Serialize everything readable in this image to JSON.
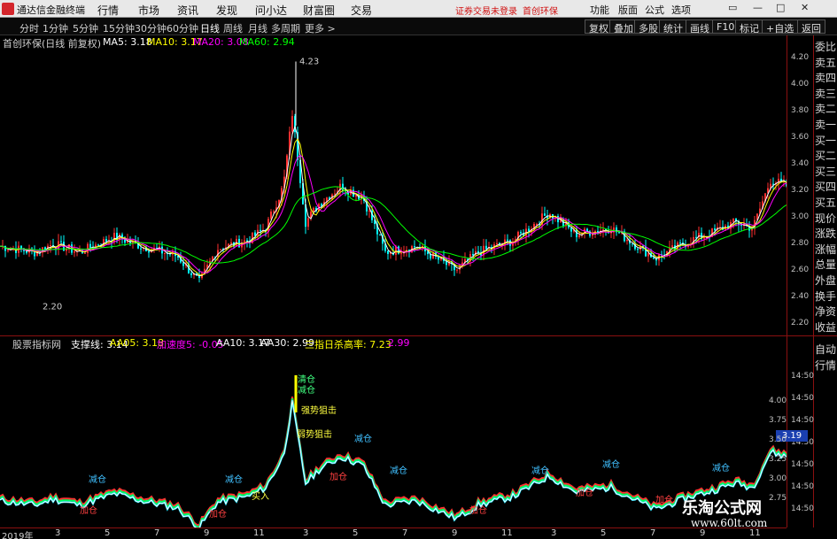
{
  "app": {
    "brand": "通达信金融终端",
    "menu": [
      "行情",
      "市场",
      "资讯",
      "发现",
      "问小达",
      "财富圈",
      "交易"
    ],
    "warning": "证券交易未登录",
    "stock_tag": "首创环保",
    "right_menu": [
      "功能",
      "版面",
      "公式",
      "选项"
    ],
    "window_buttons": [
      "▭",
      "—",
      "□",
      "✕"
    ]
  },
  "toolbar": {
    "periods": [
      "分时",
      "1分钟",
      "5分钟",
      "15分钟",
      "30分钟",
      "60分钟",
      "日线",
      "周线",
      "月线",
      "多周期",
      "更多 >"
    ],
    "active": "日线",
    "right_buttons": [
      "复权",
      "叠加",
      "多股",
      "统计",
      "画线",
      "F10",
      "标记",
      "+自选",
      "返回"
    ]
  },
  "main_chart": {
    "header": {
      "title": "首创环保(日线 前复权)",
      "ma5": "MA5: 3.18",
      "ma10": "MA10: 3.17",
      "ma20": "MA20: 3.08",
      "ma60": "MA60: 2.94"
    },
    "high_label": "4.23",
    "low_label": "2.20",
    "y_ticks": [
      "4.20",
      "4.00",
      "3.80",
      "3.60",
      "3.40",
      "3.20",
      "3.00",
      "2.80",
      "2.60",
      "2.40",
      "2.20"
    ],
    "colors": {
      "ma5": "#ffffff",
      "ma10": "#ffff00",
      "ma20": "#ff00ff",
      "ma60": "#00ff00",
      "up": "#ff3030",
      "down": "#00ffff"
    }
  },
  "sub_chart": {
    "header": {
      "title": "股票指标网",
      "support": "支撑线: 3.14",
      "aa05": "AA05: 3.18",
      "accel": "加速度5: -0.05",
      "aa10": "AA10: 3.17",
      "aa30": "AA30: 2.99",
      "rate": "三指日杀高率: 7.23",
      "extra": "2.99"
    },
    "y_ticks": [
      "14:50",
      "14:50",
      "14:50",
      "14:50",
      "14:50",
      "14:50",
      "14:50"
    ],
    "y_left": [
      "4.00",
      "3.75",
      "3.50",
      "3.25",
      "3.00",
      "2.75"
    ],
    "price_badge": "3.19",
    "annotations": {
      "qingcang": "清仓",
      "jiancang": "减仓",
      "strong": "强势狙击",
      "weak": "弱势狙击",
      "jiacang": "加仓",
      "mairu": "买入"
    }
  },
  "side_tabs": [
    "委比",
    "卖五",
    "卖四",
    "卖三",
    "卖二",
    "卖一",
    "买一",
    "买二",
    "买三",
    "买四",
    "买五",
    "现价",
    "涨跌",
    "涨幅",
    "总量",
    "外盘",
    "换手",
    "净资",
    "收益"
  ],
  "side_tabs_sub": [
    "自动",
    "行情"
  ],
  "date_axis": {
    "start": "2019年",
    "months": [
      "3",
      "5",
      "7",
      "9",
      "11",
      "3",
      "5",
      "7",
      "9",
      "11",
      "3",
      "5",
      "7",
      "9",
      "11"
    ]
  },
  "watermark": {
    "title": "乐淘公式网",
    "url": "www.60lt.com"
  }
}
